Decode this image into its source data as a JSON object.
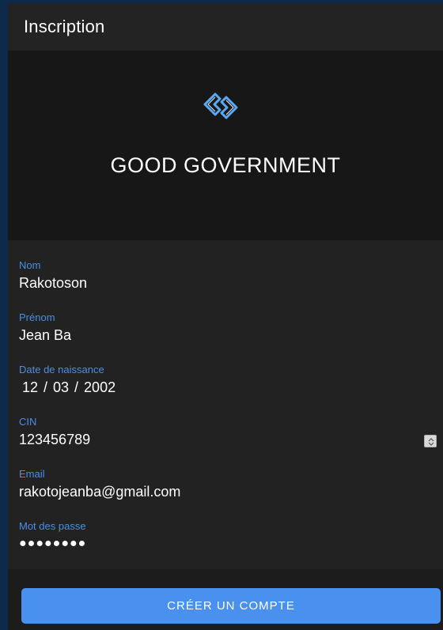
{
  "header": {
    "title": "Inscription"
  },
  "hero": {
    "logo_icon": "link-logo-icon",
    "brand_name": "GOOD GOVERNMENT"
  },
  "form": {
    "nom": {
      "label": "Nom",
      "value": "Rakotoson"
    },
    "prenom": {
      "label": "Prénom",
      "value": "Jean Ba"
    },
    "date_naissance": {
      "label": "Date de naissance",
      "value": "12 / 03 / 2002"
    },
    "cin": {
      "label": "CIN",
      "value": "123456789"
    },
    "email": {
      "label": "Email",
      "value": "rakotojeanba@gmail.com"
    },
    "password": {
      "label": "Mot des passe",
      "value": "●●●●●●●●"
    }
  },
  "actions": {
    "create_account_label": "CRÉER UN COMPTE"
  },
  "colors": {
    "accent": "#4a90ef",
    "label": "#4a8ee6",
    "background": "#1e1e1e"
  }
}
